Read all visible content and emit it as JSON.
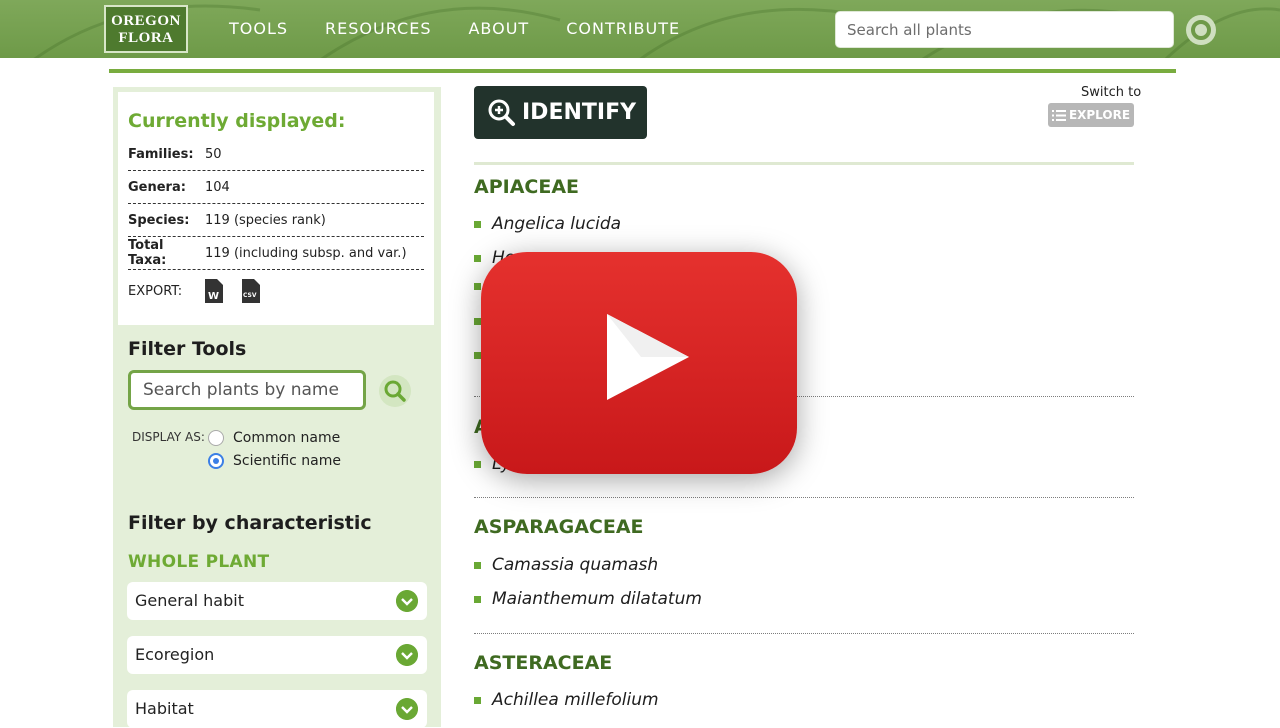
{
  "header": {
    "logo": {
      "line1": "OREGON",
      "line2": "FLORA"
    },
    "nav": [
      "TOOLS",
      "RESOURCES",
      "ABOUT",
      "CONTRIBUTE"
    ],
    "search_placeholder": "Search all plants"
  },
  "sidebar": {
    "summary_title": "Currently displayed:",
    "rows": [
      {
        "label": "Families:",
        "value": "50"
      },
      {
        "label": "Genera:",
        "value": "104"
      },
      {
        "label": "Species:",
        "value": "119 (species rank)"
      },
      {
        "label": "Total Taxa:",
        "value": "119 (including subsp. and var.)"
      }
    ],
    "export_label": "EXPORT:",
    "export_icons": [
      "word-doc-icon",
      "csv-file-icon"
    ],
    "filter_tools_title": "Filter Tools",
    "search_placeholder": "Search plants by name",
    "display_as_label": "DISPLAY AS:",
    "display_options": [
      {
        "label": "Common name",
        "checked": false
      },
      {
        "label": "Scientific name",
        "checked": true
      }
    ],
    "filter_char_title": "Filter by characteristic",
    "section_title": "WHOLE PLANT",
    "characteristics": [
      "General habit",
      "Ecoregion",
      "Habitat"
    ]
  },
  "main": {
    "identify_label": "IDENTIFY",
    "switch_to_label": "Switch to",
    "explore_label": "EXPLORE",
    "families": [
      {
        "name": "APIACEAE",
        "taxa": [
          "Angelica lucida",
          "Ho"
        ]
      },
      {
        "name": "A",
        "taxa": [
          "Lys"
        ]
      },
      {
        "name": "ASPARAGACEAE",
        "taxa": [
          "Camassia quamash",
          "Maianthemum dilatatum"
        ]
      },
      {
        "name": "ASTERACEAE",
        "taxa": [
          "Achillea millefolium"
        ]
      }
    ]
  },
  "colors": {
    "header_green": "#6e9a48",
    "accent_green": "#6eaa34",
    "family_green": "#3f6a21",
    "identify_dark": "#22332c",
    "play_red": "#e5312e"
  }
}
